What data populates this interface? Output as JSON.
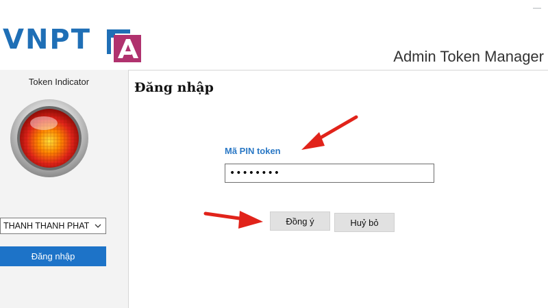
{
  "header": {
    "logo_text": "VNPT",
    "logo_mark_text": "CA",
    "app_title": "Admin Token Manager",
    "window_control": "—"
  },
  "sidebar": {
    "token_indicator_label": "Token Indicator",
    "token_select_value": "THANH THANH PHAT",
    "login_button_label": "Đăng nhập"
  },
  "main": {
    "title": "Đăng nhập",
    "pin_label": "Mã PIN token",
    "pin_value": "••••••••",
    "ok_label": "Đồng ý",
    "cancel_label": "Huỷ bỏ"
  },
  "colors": {
    "brand_blue": "#1f6fb6",
    "brand_magenta": "#b0326e",
    "button_primary": "#1d73c8",
    "annotation_red": "#e1231a"
  },
  "icons": {
    "led": "token-indicator-led-icon",
    "dropdown": "chevron-down-icon",
    "annotation": "arrow-annotation-icon"
  }
}
